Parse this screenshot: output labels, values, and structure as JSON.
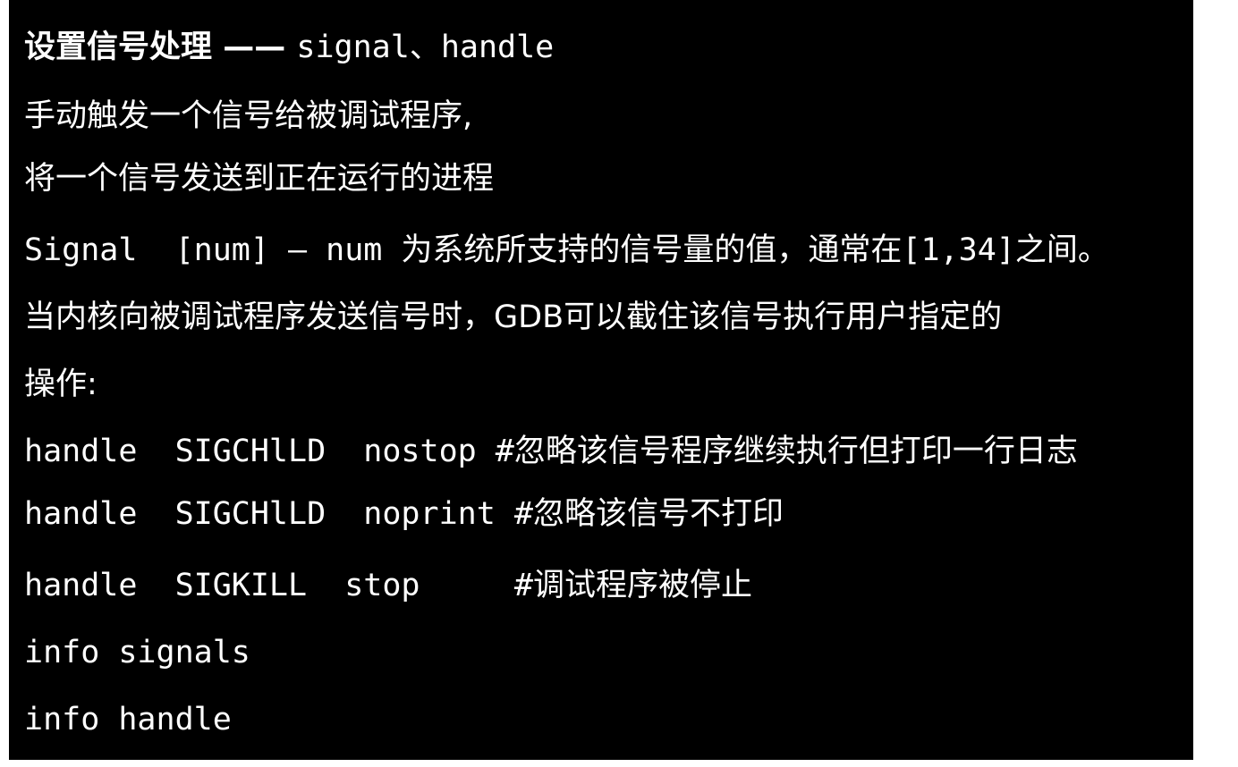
{
  "slide": {
    "title_cn": "设置信号处理",
    "title_dash": " —— ",
    "title_cmd": "signal、handle",
    "lines": [
      "手动触发一个信号给被调试程序,",
      "将一个信号发送到正在运行的进程",
      "Signal  [num] – num 为系统所支持的信号量的值，通常在[1,34]之间。",
      "当内核向被调试程序发送信号时，GDB可以截住该信号执行用户指定的",
      "操作:",
      "handle  SIGCHlLD  nostop #忽略该信号程序继续执行但打印一行日志",
      "handle  SIGCHlLD  noprint #忽略该信号不打印",
      "handle  SIGKILL  stop     #调试程序被停止",
      "info signals",
      "info handle"
    ]
  },
  "colors": {
    "background": "#000000",
    "text": "#ffffff",
    "page": "#ffffff"
  }
}
